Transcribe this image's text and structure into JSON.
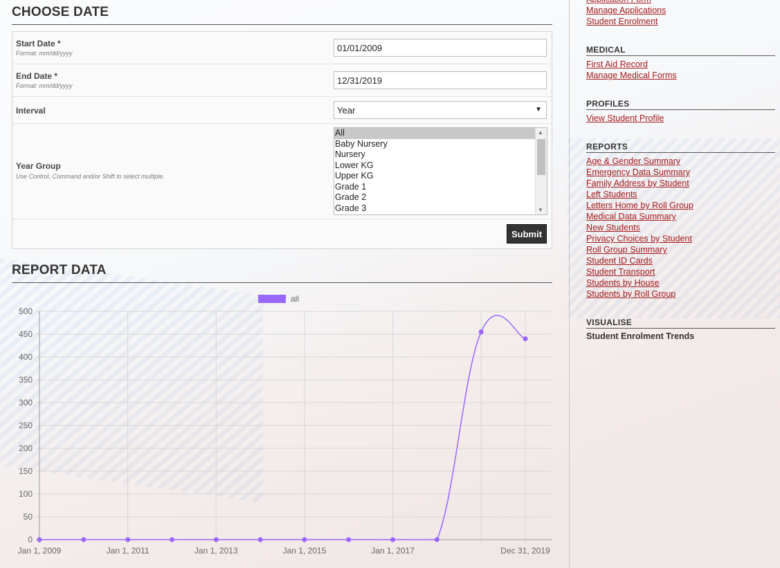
{
  "choose_date": {
    "heading": "CHOOSE DATE",
    "start_label": "Start Date *",
    "start_hint": "Format: mm/dd/yyyy",
    "start_value": "01/01/2009",
    "end_label": "End Date *",
    "end_hint": "Format: mm/dd/yyyy",
    "end_value": "12/31/2019",
    "interval_label": "Interval",
    "interval_value": "Year",
    "year_group_label": "Year Group",
    "year_group_hint": "Use Control, Command and/or Shift to select multiple.",
    "year_group_options": [
      "All",
      "Baby Nursery",
      "Nursery",
      "Lower KG",
      "Upper KG",
      "Grade 1",
      "Grade 2",
      "Grade 3"
    ],
    "year_group_selected": "All",
    "submit_label": "Submit"
  },
  "report": {
    "heading": "REPORT DATA"
  },
  "chart_data": {
    "type": "line",
    "series": [
      {
        "name": "all",
        "color": "#9966ff",
        "x": [
          "Jan 1, 2009",
          "Jan 1, 2010",
          "Jan 1, 2011",
          "Jan 1, 2012",
          "Jan 1, 2013",
          "Jan 1, 2014",
          "Jan 1, 2015",
          "Jan 1, 2016",
          "Jan 1, 2017",
          "Jan 1, 2018",
          "Jan 1, 2019",
          "Dec 31, 2019"
        ],
        "values": [
          0,
          0,
          0,
          0,
          0,
          0,
          0,
          0,
          0,
          0,
          455,
          440
        ]
      }
    ],
    "x_tick_labels": [
      "Jan 1, 2009",
      "Jan 1, 2011",
      "Jan 1, 2013",
      "Jan 1, 2015",
      "Jan 1, 2017",
      "Dec 31, 2019"
    ],
    "y_ticks": [
      0,
      50,
      100,
      150,
      200,
      250,
      300,
      350,
      400,
      450,
      500
    ],
    "ylim": [
      0,
      500
    ],
    "grid": true,
    "legend_position": "top-center"
  },
  "sidebar": {
    "top_links": [
      "Application Form",
      "Manage Applications",
      "Student Enrolment"
    ],
    "medical": {
      "heading": "MEDICAL",
      "links": [
        "First Aid Record",
        "Manage Medical Forms"
      ]
    },
    "profiles": {
      "heading": "PROFILES",
      "links": [
        "View Student Profile"
      ]
    },
    "reports": {
      "heading": "REPORTS",
      "links": [
        "Age & Gender Summary",
        "Emergency Data Summary",
        "Family Address by Student",
        "Left Students",
        "Letters Home by Roll Group",
        "Medical Data Summary",
        "New Students",
        "Privacy Choices by Student",
        "Roll Group Summary",
        "Student ID Cards",
        "Student Transport",
        "Students by House",
        "Students by Roll Group"
      ]
    },
    "visualise": {
      "heading": "VISUALISE",
      "current": "Student Enrolment Trends"
    }
  }
}
